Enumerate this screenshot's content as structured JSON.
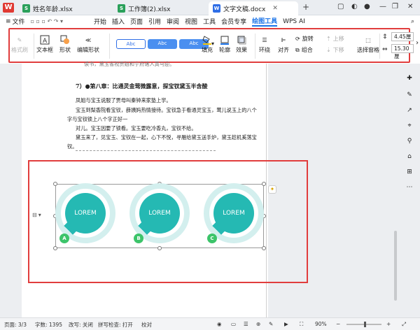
{
  "tabs": {
    "home_logo": "W",
    "items": [
      {
        "label": "姓名年龄.xlsx",
        "icon_letter": "S",
        "color": "#2aa05a"
      },
      {
        "label": "工作簿(2).xlsx",
        "icon_letter": "S",
        "color": "#2aa05a"
      },
      {
        "label": "文字文稿.docx",
        "icon_letter": "W",
        "color": "#2f6ee6",
        "active": true
      }
    ],
    "plus": "+"
  },
  "menubar": {
    "file": "文件",
    "items": [
      "开始",
      "插入",
      "页面",
      "引用",
      "审阅",
      "视图",
      "工具",
      "会员专享",
      "绘图工具",
      "WPS AI"
    ],
    "active": "绘图工具"
  },
  "ribbon": {
    "format_painter": "格式刷",
    "textbox": "文本框",
    "shape": "形状",
    "edit_shape": "编辑形状",
    "style_boxes": [
      "Abc",
      "Abc",
      "Abc"
    ],
    "fill": "填充",
    "outline": "轮廓",
    "effect": "效果",
    "wrap": "环绕",
    "align": "对齐",
    "rotate": "旋转",
    "group": "组合",
    "bring_forward": "上移",
    "send_backward": "下移",
    "selection_pane": "选择窗格",
    "height": "4.45厘",
    "width": "15.30厘"
  },
  "document": {
    "lines": [
      {
        "text": "读书，黛玉省视贾姐和宁府诸入黄马迎。",
        "heading": false
      },
      {
        "text": "7）●第八章：比通灵金莺微露意，探宝钗黛玉半含酸",
        "heading": true
      },
      {
        "text": "凤姐与宝玉说服了贾母叫秦钟来家塾上学。",
        "heading": false
      },
      {
        "text": "宝玉到梨香院看宝钗，薛姨妈热情接待。宝钗急于看通灵宝玉，莺儿说玉上的八个",
        "heading": false
      },
      {
        "text": "字与宝钗锁上八个字正好一",
        "heading": false
      },
      {
        "text": "对儿。宝玉因要了锁看。宝玉要吃冷香丸，宝钗不给。",
        "heading": false
      },
      {
        "text": "黛玉来了，见宝玉、宝钗在一起，心下不悦，寻雁给黛玉送手炉，黛玉趁机奚落宝",
        "heading": false
      },
      {
        "text": "钗。",
        "heading": false
      }
    ],
    "circles": [
      {
        "label": "LOREM",
        "badge": "A"
      },
      {
        "label": "LOREM",
        "badge": "B"
      },
      {
        "label": "LOREM",
        "badge": "C"
      }
    ]
  },
  "statusbar": {
    "page": "页面: 3/3",
    "words": "字数: 1395",
    "revision": "改写: 关闭",
    "spellcheck": "拼写检查: 打开",
    "proofread": "校对",
    "zoom": "90%"
  },
  "colors": {
    "teal": "#25b9b3",
    "badge_green": "#3cc46a",
    "highlight_red": "#e13d3d",
    "accent_blue": "#1a73e8"
  }
}
